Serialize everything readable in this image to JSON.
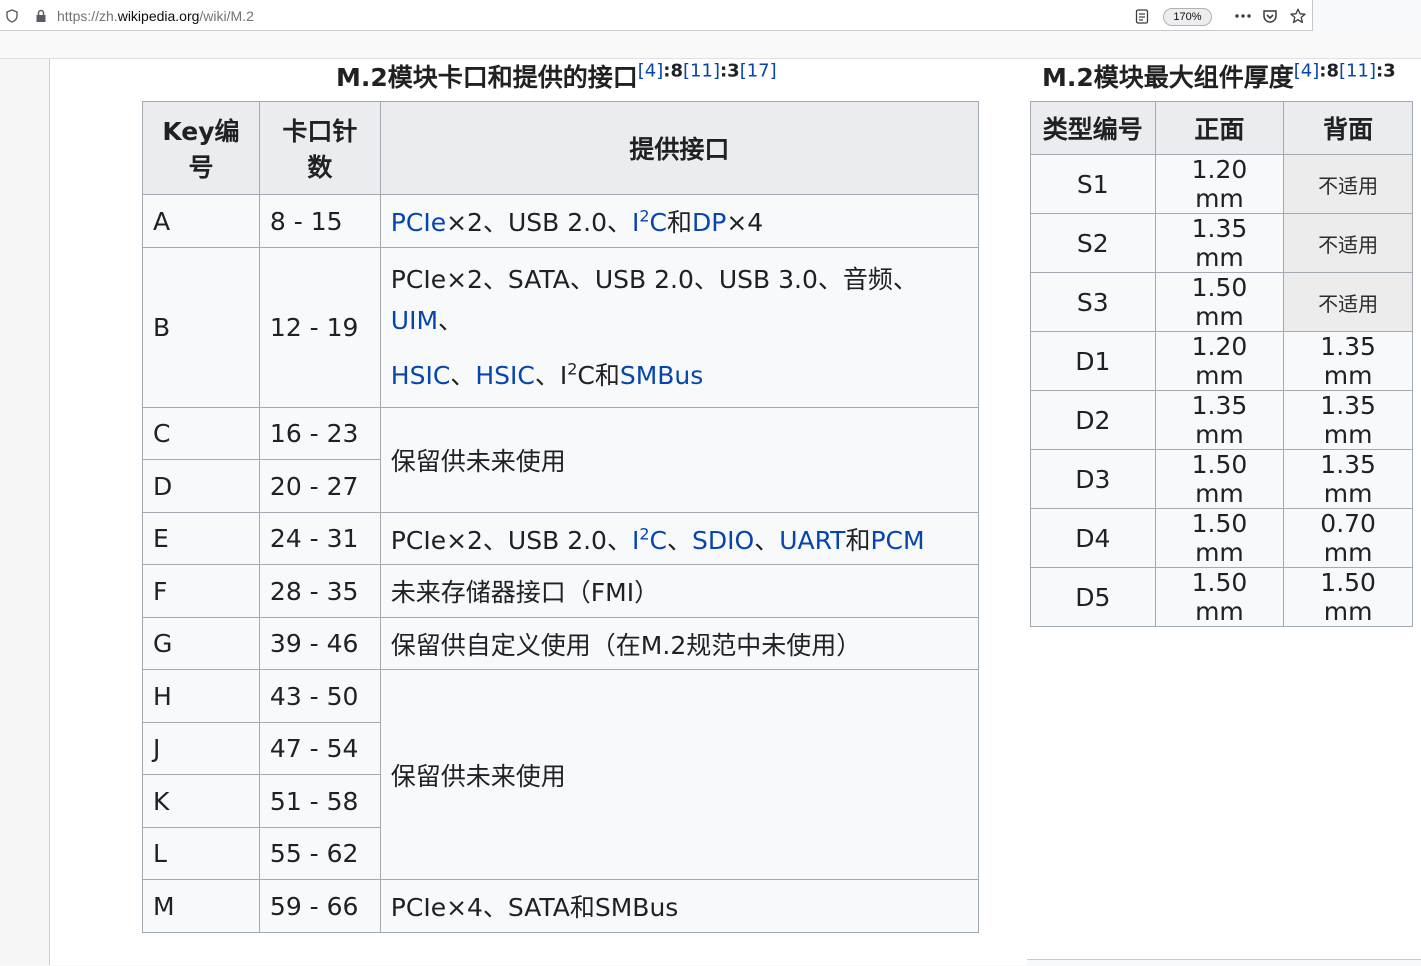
{
  "browser": {
    "url_prefix": "https://zh.",
    "url_domain": "wikipedia.org",
    "url_path": "/wiki/M.2",
    "zoom": "170%"
  },
  "table1": {
    "caption": "M.2模块卡口和提供的接口",
    "caption_refs": [
      "[4]",
      ":8",
      "[11]",
      ":3",
      "[17]"
    ],
    "headers": [
      "Key编号",
      "卡口针数",
      "提供接口"
    ],
    "header_key_lines": [
      "Key编",
      "号"
    ],
    "header_pins_lines": [
      "卡口针",
      "数"
    ],
    "rows": {
      "A": {
        "key": "A",
        "pins": "8 - 15"
      },
      "B": {
        "key": "B",
        "pins": "12 - 19"
      },
      "C": {
        "key": "C",
        "pins": "16 - 23"
      },
      "D": {
        "key": "D",
        "pins": "20 - 27"
      },
      "E": {
        "key": "E",
        "pins": "24 - 31"
      },
      "F": {
        "key": "F",
        "pins": "28 - 35"
      },
      "G": {
        "key": "G",
        "pins": "39 - 46"
      },
      "H": {
        "key": "H",
        "pins": "43 - 50"
      },
      "J": {
        "key": "J",
        "pins": "47 - 54"
      },
      "K": {
        "key": "K",
        "pins": "51 - 58"
      },
      "L": {
        "key": "L",
        "pins": "55 - 62"
      },
      "M": {
        "key": "M",
        "pins": "59 - 66"
      }
    },
    "iface": {
      "A": {
        "pcie": "PCIe",
        "t1": "×2、USB 2.0、",
        "i": "I",
        "two": "2",
        "c": "C",
        "he": "和",
        "dp": "DP",
        "t2": "×4"
      },
      "B": {
        "l1": "PCIe×2、SATA、USB 2.0、USB 3.0、音频、",
        "uim": "UIM",
        "dun": "、",
        "hsic1": "HSIC",
        "sep1": "、",
        "hsic2": "HSIC",
        "sep2": "、I",
        "two": "2",
        "c": "C和",
        "smbus": "SMBus"
      },
      "CD": "保留供未来使用",
      "E": {
        "t1": "PCIe×2、USB 2.0、",
        "i2c": "I",
        "two": "2",
        "c": "C",
        "sep1": "、",
        "sdio": "SDIO",
        "sep2": "、",
        "uart": "UART",
        "he": "和",
        "pcm": "PCM"
      },
      "F": "未来存储器接口（FMI）",
      "G": "保留供自定义使用（在M.2规范中未使用）",
      "HL": "保留供未来使用",
      "M": "PCIe×4、SATA和SMBus"
    }
  },
  "table2": {
    "caption": "M.2模块最大组件厚度",
    "caption_refs": [
      "[4]",
      ":8",
      "[11]",
      ":3"
    ],
    "headers": [
      "类型编号",
      "正面",
      "背面"
    ],
    "rows": [
      {
        "type": "S1",
        "front": "1.20 mm",
        "back": "不适用"
      },
      {
        "type": "S2",
        "front": "1.35 mm",
        "back": "不适用"
      },
      {
        "type": "S3",
        "front": "1.50 mm",
        "back": "不适用"
      },
      {
        "type": "D1",
        "front": "1.20 mm",
        "back": "1.35 mm"
      },
      {
        "type": "D2",
        "front": "1.35 mm",
        "back": "1.35 mm"
      },
      {
        "type": "D3",
        "front": "1.50 mm",
        "back": "1.35 mm"
      },
      {
        "type": "D4",
        "front": "1.50 mm",
        "back": "0.70 mm"
      },
      {
        "type": "D5",
        "front": "1.50 mm",
        "back": "1.50 mm"
      }
    ]
  }
}
